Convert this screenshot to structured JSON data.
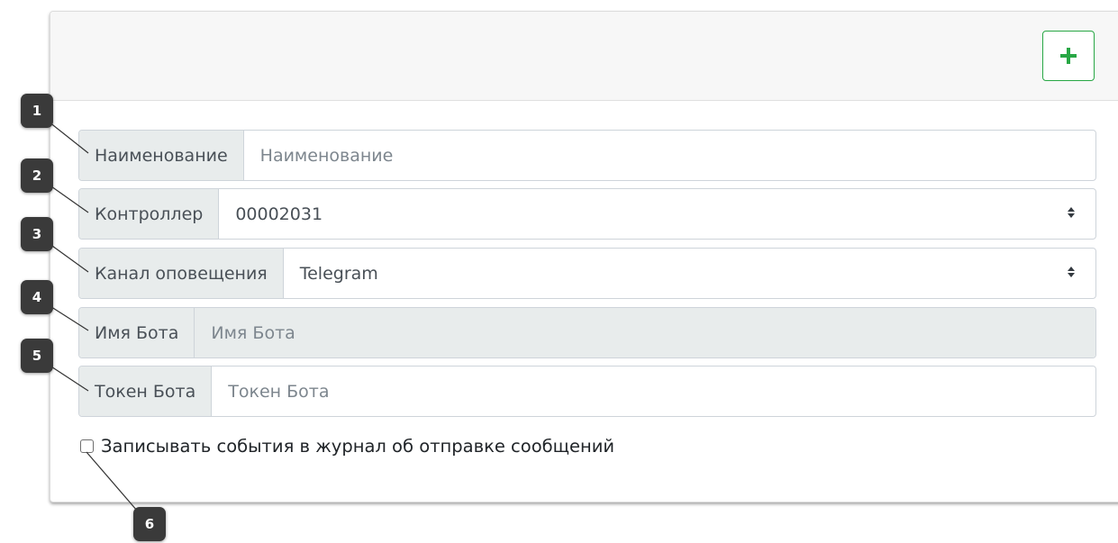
{
  "header": {
    "add_button_icon": "plus-icon",
    "add_button_color": "#28a745"
  },
  "form": {
    "name": {
      "label": "Наименование",
      "placeholder": "Наименование"
    },
    "controller": {
      "label": "Контроллер",
      "value": "00002031"
    },
    "channel": {
      "label": "Канал оповещения",
      "value": "Telegram"
    },
    "bot_name": {
      "label": "Имя Бота",
      "placeholder": "Имя Бота"
    },
    "bot_token": {
      "label": "Токен Бота",
      "placeholder": "Токен Бота"
    },
    "log_checkbox": {
      "label": "Записывать события в журнал об отправке сообщений",
      "checked": false
    }
  },
  "callouts": [
    "1",
    "2",
    "3",
    "4",
    "5",
    "6"
  ]
}
